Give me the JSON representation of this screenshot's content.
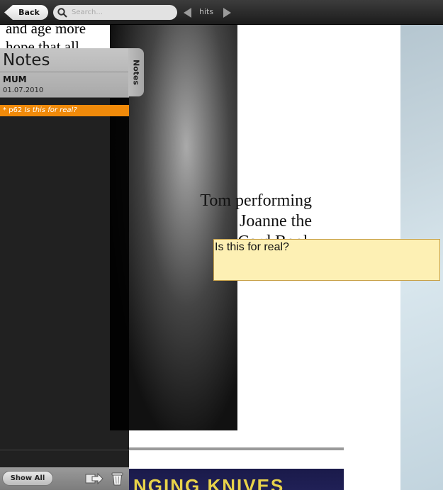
{
  "toolbar": {
    "back_label": "Back",
    "search_placeholder": "Search...",
    "hits_label": "hits"
  },
  "page": {
    "prior_text_lines": [
      "and age more",
      "hope that all"
    ],
    "caption_lines": [
      "Tom performing",
      "Joanne the",
      "Card Book"
    ],
    "next_section_banner": "NGING KNIVES"
  },
  "sticky_note": {
    "text": "Is this for real?"
  },
  "notes_panel": {
    "title": "Notes",
    "tab_label": "Notes",
    "user": "MUM",
    "date": "01.07.2010",
    "items": [
      {
        "marker": "*",
        "page": "p62",
        "text": "Is this for real?"
      }
    ],
    "show_all_label": "Show All"
  },
  "colors": {
    "accent": "#f08a0a",
    "sticky_bg": "#fdf0b4",
    "toolbar_bg": "#2a2a2a"
  },
  "icons": [
    "back-arrow-icon",
    "search-icon",
    "prev-arrow-icon",
    "next-arrow-icon",
    "export-icon",
    "trash-icon"
  ]
}
